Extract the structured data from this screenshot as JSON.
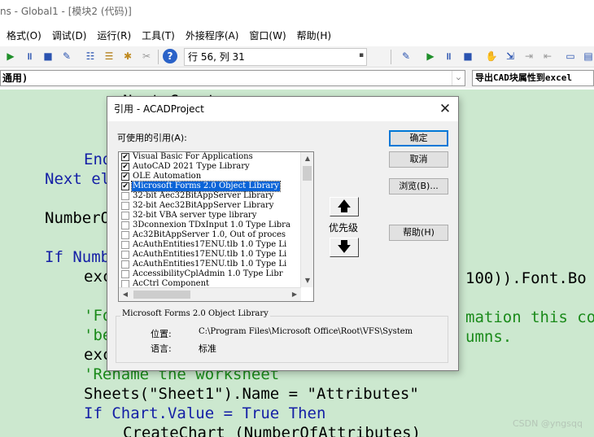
{
  "window": {
    "title": "ns - Global1 - [模块2 (代码)]"
  },
  "menu": [
    "格式(O)",
    "调试(D)",
    "运行(R)",
    "工具(T)",
    "外接程序(A)",
    "窗口(W)",
    "帮助(H)"
  ],
  "toolbar": {
    "position": "行 56, 列 31"
  },
  "combos": {
    "object": "通用)",
    "procedure": "导出CAD块属性到excel"
  },
  "code_lines": [
    {
      "indent": 4,
      "parts": [
        {
          "t": "Next Count",
          "c": "n"
        }
      ]
    },
    {
      "indent": 2,
      "parts": [
        {
          "t": "End If",
          "c": "kw"
        }
      ]
    },
    {
      "indent": 0,
      "parts": [
        {
          "t": "Next el",
          "c": "kw"
        }
      ]
    },
    {
      "indent": 0,
      "parts": [
        {
          "t": "NumberO",
          "c": "n"
        }
      ]
    },
    {
      "indent": 0,
      "parts": [
        {
          "t": "If Numb",
          "c": "kw"
        }
      ]
    },
    {
      "indent": 2,
      "parts": [
        {
          "t": "exc",
          "c": "n"
        }
      ]
    },
    {
      "indent": 2,
      "parts": [
        {
          "t": "'Fo",
          "c": "cm"
        }
      ]
    },
    {
      "indent": 2,
      "parts": [
        {
          "t": "'be",
          "c": "cm"
        }
      ]
    },
    {
      "indent": 2,
      "parts": [
        {
          "t": "exc",
          "c": "n"
        }
      ]
    },
    {
      "indent": 2,
      "parts": [
        {
          "t": "'Rename the worksheet",
          "c": "cm"
        }
      ]
    },
    {
      "indent": 2,
      "parts": [
        {
          "t": "Sheets(\"Sheet1\").Name = \"Attributes\"",
          "c": "n"
        }
      ]
    },
    {
      "indent": 2,
      "parts": [
        {
          "t": "If Chart.Value = True Then",
          "c": "kw"
        }
      ]
    },
    {
      "indent": 4,
      "parts": [
        {
          "t": "CreateChart (NumberOfAttributes)",
          "c": "n"
        }
      ]
    }
  ],
  "code_tails": {
    "font_bold": "100)).Font.Bo",
    "comment1": "mation this co",
    "comment2": "umns."
  },
  "watermark": "CSDN @yngsqq",
  "dialog": {
    "title": "引用 - ACADProject",
    "available_label": "可使用的引用(A):",
    "references": [
      {
        "name": "Visual Basic For Applications",
        "checked": true
      },
      {
        "name": "AutoCAD 2021 Type Library",
        "checked": true
      },
      {
        "name": "OLE Automation",
        "checked": true
      },
      {
        "name": "Microsoft Forms 2.0 Object Library",
        "checked": true,
        "selected": true
      },
      {
        "name": "32-bit Aec32BitAppServer Library",
        "checked": false
      },
      {
        "name": "32-bit Aec32BitAppServer Library",
        "checked": false
      },
      {
        "name": "32-bit VBA server type library",
        "checked": false
      },
      {
        "name": "3Dconnexion TDxInput 1.0 Type Libra",
        "checked": false
      },
      {
        "name": "Ac32BitAppServer 1.0, Out of proces",
        "checked": false
      },
      {
        "name": "AcAuthEntities17ENU.tlb 1.0 Type Li",
        "checked": false
      },
      {
        "name": "AcAuthEntities17ENU.tlb 1.0 Type Li",
        "checked": false
      },
      {
        "name": "AcAuthEntities17ENU.tlb 1.0 Type Li",
        "checked": false
      },
      {
        "name": "AccessibilityCplAdmin 1.0 Type Libr",
        "checked": false
      },
      {
        "name": "AcCtrl Component",
        "checked": false
      }
    ],
    "priority_label": "优先级",
    "buttons": {
      "ok": "确定",
      "cancel": "取消",
      "browse": "浏览(B)...",
      "help": "帮助(H)"
    },
    "description": {
      "title": "Microsoft Forms 2.0 Object Library",
      "location_label": "位置:",
      "location": "C:\\Program Files\\Microsoft Office\\Root\\VFS\\System",
      "language_label": "语言:",
      "language": "标准"
    }
  }
}
